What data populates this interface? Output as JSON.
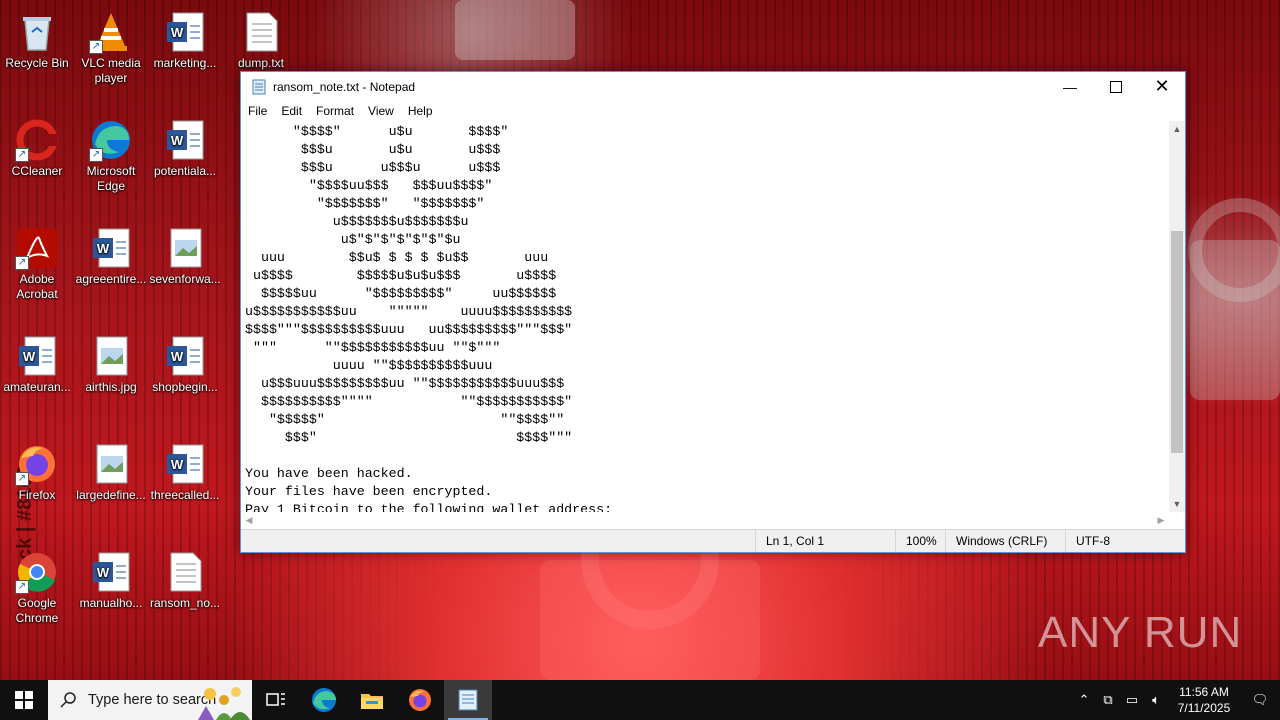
{
  "desktop_icons": [
    {
      "label": "Recycle Bin",
      "icon": "recycle-bin-icon"
    },
    {
      "label": "VLC media player",
      "icon": "vlc-icon"
    },
    {
      "label": "marketing...",
      "icon": "word-doc-icon"
    },
    {
      "label": "dump.txt",
      "icon": "text-file-icon"
    },
    {
      "label": "CCleaner",
      "icon": "ccleaner-icon"
    },
    {
      "label": "Microsoft Edge",
      "icon": "edge-icon"
    },
    {
      "label": "potentiala...",
      "icon": "word-doc-icon"
    },
    {
      "label": "Adobe Acrobat",
      "icon": "acrobat-icon"
    },
    {
      "label": "agreeentire...",
      "icon": "word-doc-icon"
    },
    {
      "label": "sevenforwa...",
      "icon": "image-file-icon"
    },
    {
      "label": "amateuran...",
      "icon": "word-doc-icon"
    },
    {
      "label": "airthis.jpg",
      "icon": "image-file-icon"
    },
    {
      "label": "shopbegin...",
      "icon": "word-doc-icon"
    },
    {
      "label": "Firefox",
      "icon": "firefox-icon"
    },
    {
      "label": "largedefine...",
      "icon": "image-file-icon"
    },
    {
      "label": "threecalled...",
      "icon": "word-doc-icon"
    },
    {
      "label": "Google Chrome",
      "icon": "chrome-icon"
    },
    {
      "label": "manualho...",
      "icon": "word-doc-icon"
    },
    {
      "label": "ransom_no...",
      "icon": "text-file-icon"
    }
  ],
  "notepad": {
    "title": "ransom_note.txt - Notepad",
    "menu": [
      "File",
      "Edit",
      "Format",
      "View",
      "Help"
    ],
    "content": "      \"$$$$\"      u$u       $$$$\"\n       $$$u       u$u       u$$$\n       $$$u      u$$$u      u$$$\n        \"$$$$uu$$$   $$$uu$$$$\"\n         \"$$$$$$$\"   \"$$$$$$$\"\n           u$$$$$$$u$$$$$$$u\n            u$\"$\"$\"$\"$\"$\"$u\n  uuu        $$u$ $ $ $ $u$$       uuu\n u$$$$        $$$$$u$u$u$$$       u$$$$\n  $$$$$uu      \"$$$$$$$$$\"     uu$$$$$$\nu$$$$$$$$$$$uu    \"\"\"\"\"    uuuu$$$$$$$$$$\n$$$$\"\"\"$$$$$$$$$$uuu   uu$$$$$$$$$\"\"\"$$$\"\n \"\"\"      \"\"$$$$$$$$$$$uu \"\"$\"\"\"\n           uuuu \"\"$$$$$$$$$$uuu\n  u$$$uuu$$$$$$$$$uu \"\"$$$$$$$$$$$uuu$$$\n  $$$$$$$$$$\"\"\"\"           \"\"$$$$$$$$$$$\"\n   \"$$$$$\"                      \"\"$$$$\"\"\n     $$$\"                         $$$$\"\"\"\n\nYou have been hacked.\nYour files have been encrypted.\nPay 1 Bitcoin to the following wallet address:",
    "status": {
      "position": "Ln 1, Col 1",
      "zoom": "100%",
      "line_ending": "Windows (CRLF)",
      "encoding": "UTF-8"
    }
  },
  "taskbar": {
    "search_placeholder": "Type here to search",
    "time": "11:56 AM",
    "date": "7/11/2025"
  },
  "watermark": "ANY RUN",
  "side_watermark": "ck | #8166"
}
